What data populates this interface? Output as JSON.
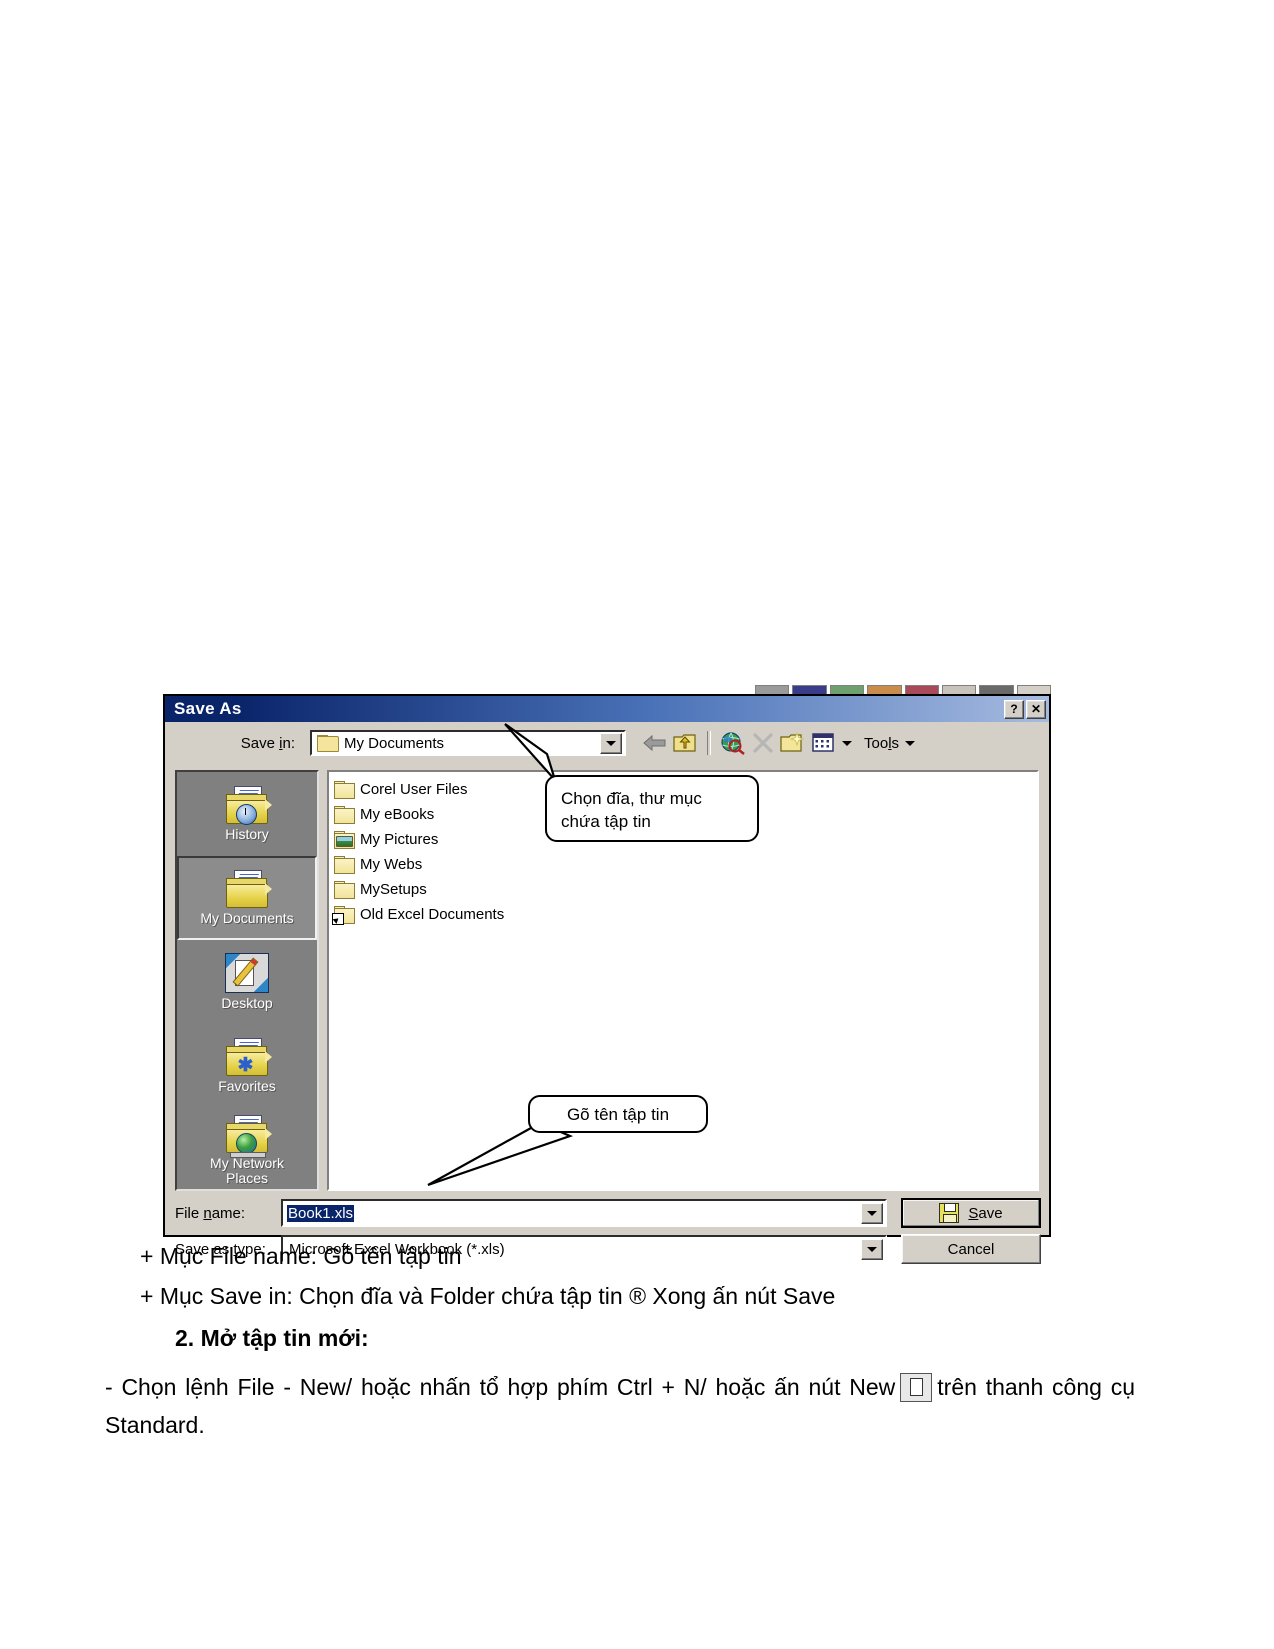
{
  "dialog": {
    "title": "Save As",
    "titlebar_buttons": [
      {
        "name": "help-button",
        "glyph": "?"
      },
      {
        "name": "close-button",
        "glyph": "✕"
      }
    ],
    "save_in": {
      "label": "Save in:",
      "label_underline_char": "i",
      "value": "My Documents",
      "icon": "folder-icon"
    },
    "toolbar": [
      {
        "name": "back-button",
        "icon": "left-arrow-icon",
        "tooltip": "Back"
      },
      {
        "name": "up-one-level-button",
        "icon": "up-folder-icon",
        "tooltip": "Up One Level"
      },
      {
        "name": "search-web-button",
        "icon": "globe-search-icon",
        "tooltip": "Search the Web"
      },
      {
        "name": "delete-button",
        "icon": "x-delete-icon",
        "tooltip": "Delete"
      },
      {
        "name": "new-folder-button",
        "icon": "new-folder-icon",
        "tooltip": "Create New Folder"
      },
      {
        "name": "views-button",
        "icon": "views-grid-icon",
        "tooltip": "Views"
      }
    ],
    "tools_menu": {
      "label": "Tools",
      "underline_char": "l"
    },
    "places_bar": [
      {
        "name": "history",
        "label": "History",
        "icon": "history-folder-icon",
        "selected": false
      },
      {
        "name": "my-documents",
        "label": "My Documents",
        "icon": "my-documents-folder-icon",
        "selected": true
      },
      {
        "name": "desktop",
        "label": "Desktop",
        "icon": "desktop-icon",
        "selected": false
      },
      {
        "name": "favorites",
        "label": "Favorites",
        "icon": "favorites-folder-icon",
        "selected": false
      },
      {
        "name": "my-network-places",
        "label": "My Network\nPlaces",
        "label_line1": "My Network",
        "label_line2": "Places",
        "icon": "network-places-folder-icon",
        "selected": false
      }
    ],
    "file_list": [
      {
        "name": "Corel User Files",
        "icon": "folder-icon",
        "kind": "folder"
      },
      {
        "name": "My eBooks",
        "icon": "folder-icon",
        "kind": "folder"
      },
      {
        "name": "My Pictures",
        "icon": "pictures-folder-icon",
        "kind": "folder"
      },
      {
        "name": "My Webs",
        "icon": "folder-icon",
        "kind": "folder"
      },
      {
        "name": "MySetups",
        "icon": "folder-icon",
        "kind": "folder"
      },
      {
        "name": "Old Excel Documents",
        "icon": "folder-shortcut-icon",
        "kind": "shortcut"
      }
    ],
    "file_name": {
      "label": "File name:",
      "label_underline_char": "n",
      "value": "Book1.xls",
      "selected": true
    },
    "save_as_type": {
      "label": "Save as type:",
      "label_underline_char": "t",
      "value": "Microsoft Excel Workbook (*.xls)"
    },
    "buttons": {
      "save": "Save",
      "save_underline_char": "S",
      "cancel": "Cancel"
    }
  },
  "callouts": {
    "save_in": "Chọn đĩa, thư mục chứa tập tin",
    "save_in_line1": "Chọn đĩa, thư mục",
    "save_in_line2": "chứa tập tin",
    "file_name": "Gõ tên tập tin"
  },
  "body": {
    "line1": "+ Mục File name: Gõ tên tập tin",
    "line2": "+ Mục Save in: Chọn đĩa và Folder chứa tập tin ® Xong ấn nút Save",
    "line3": "2. Mở tập tin mới:",
    "para_before": "- Chọn lệnh File - New/ hoặc nhấn tổ hợp phím Ctrl + N/ hoặc ấn nút New",
    "para_after": "trên thanh công cụ Standard.",
    "new_icon_name": "new-document-icon"
  },
  "colors": {
    "titlebar_start": "#0a246a",
    "titlebar_end": "#a6bbe0",
    "dialog_face": "#d4d0c8",
    "places_bar": "#808080",
    "selection": "#0a246a",
    "folder_yellow": "#f2e49a"
  }
}
